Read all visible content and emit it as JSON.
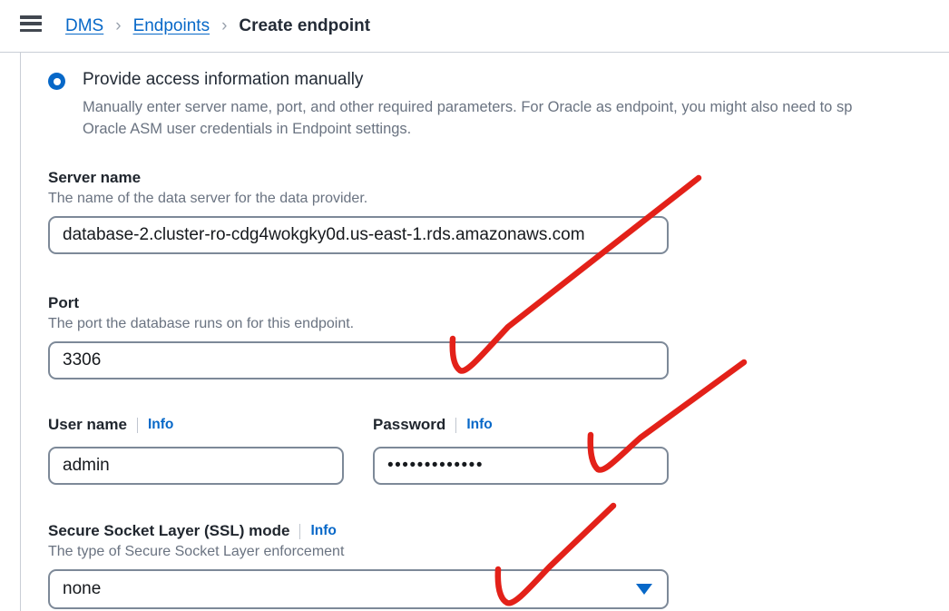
{
  "breadcrumb": {
    "menu_icon": "hamburger-menu-icon",
    "items": [
      {
        "label": "DMS",
        "current": false
      },
      {
        "label": "Endpoints",
        "current": false
      },
      {
        "label": "Create endpoint",
        "current": true
      }
    ],
    "separator": "›"
  },
  "access_option": {
    "selected": true,
    "label": "Provide access information manually",
    "description_line1": "Manually enter server name, port, and other required parameters. For Oracle as endpoint, you might also need to sp",
    "description_line2": "Oracle ASM user credentials in Endpoint settings."
  },
  "fields": {
    "server_name": {
      "label": "Server name",
      "description": "The name of the data server for the data provider.",
      "value": "database-2.cluster-ro-cdg4wokgky0d.us-east-1.rds.amazonaws.com",
      "placeholder": ""
    },
    "port": {
      "label": "Port",
      "description": "The port the database runs on for this endpoint.",
      "value": "3306",
      "placeholder": ""
    },
    "user_name": {
      "label": "User name",
      "info": "Info",
      "value": "admin",
      "placeholder": ""
    },
    "password": {
      "label": "Password",
      "info": "Info",
      "value": "•••••••••••••",
      "placeholder": ""
    },
    "ssl_mode": {
      "label": "Secure Socket Layer (SSL) mode",
      "info": "Info",
      "description": "The type of Secure Socket Layer enforcement",
      "value": "none",
      "caret_icon": "chevron-down-icon"
    }
  },
  "annotations": {
    "color": "#e32119",
    "marks": [
      {
        "name": "check-mark-server-name"
      },
      {
        "name": "check-mark-password"
      },
      {
        "name": "check-mark-ssl-mode"
      }
    ]
  },
  "colors": {
    "link": "#0768c8",
    "text": "#232b36",
    "muted": "#6a7381",
    "border": "#7d8998",
    "annotation": "#e32119"
  }
}
